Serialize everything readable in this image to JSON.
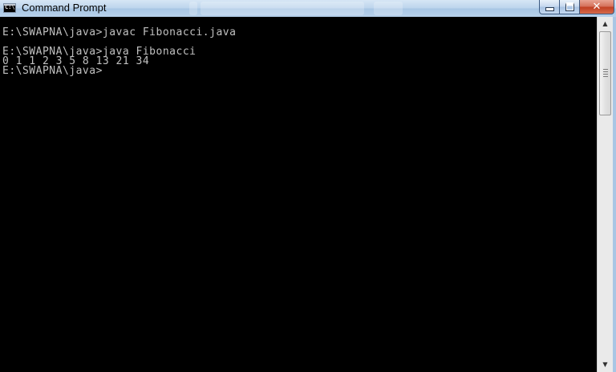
{
  "window": {
    "title": "Command Prompt",
    "icon": "cmd-icon",
    "icon_glyph": "C:\\"
  },
  "caption_buttons": {
    "minimize_icon": "minimize-icon",
    "maximize_icon": "maximize-icon",
    "close_icon": "close-icon",
    "close_glyph": "✕"
  },
  "console": {
    "background": "#000000",
    "foreground": "#c0c0c0",
    "lines": [
      "",
      "E:\\SWAPNA\\java>javac Fibonacci.java",
      "",
      "E:\\SWAPNA\\java>java Fibonacci",
      "0 1 1 2 3 5 8 13 21 34",
      "E:\\SWAPNA\\java>"
    ]
  },
  "scrollbar": {
    "up_glyph": "▲",
    "down_glyph": "▼"
  }
}
